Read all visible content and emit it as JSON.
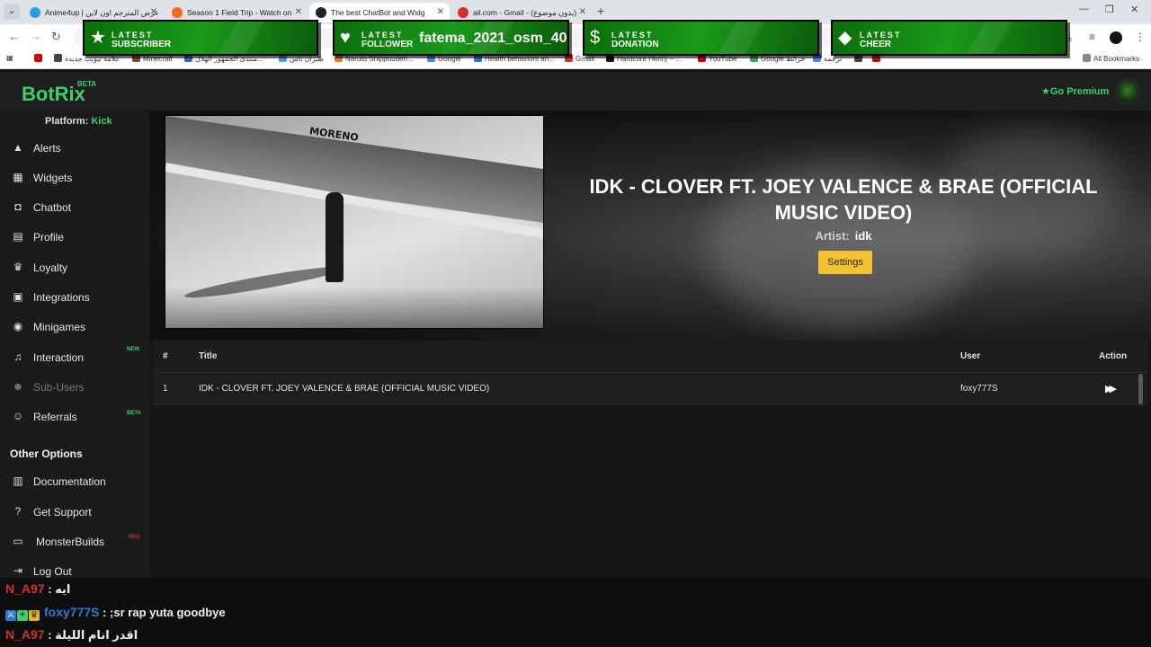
{
  "browser": {
    "tabs": [
      {
        "label": "Anime4up | عرض المترجم اون لاين",
        "color": "#2f9ae0"
      },
      {
        "label": "Season 1 Field Trip - Watch on",
        "color": "#f26b1d"
      },
      {
        "label": "The best ChatBot and Widg",
        "color": "#222222"
      },
      {
        "label": "ail.com - Gmail - (بدون موضوع)",
        "color": "#d93025"
      }
    ],
    "bookmarks": [
      {
        "label": "",
        "color": "#d30000"
      },
      {
        "label": "علامة تبويب جديدة",
        "color": "#444444"
      },
      {
        "label": "Minecraft",
        "color": "#6b4f2a"
      },
      {
        "label": "منتدى الجمهور الهلال...",
        "color": "#2b6cb0"
      },
      {
        "label": "طيران ناس",
        "color": "#3a9fd8"
      },
      {
        "label": "Naruto Shippuuden...",
        "color": "#e07a20"
      },
      {
        "label": "Google",
        "color": "#4285f4"
      },
      {
        "label": "Health behaviors an...",
        "color": "#1a73e8"
      },
      {
        "label": "Gmail",
        "color": "#d93025"
      },
      {
        "label": "Hardcore Henry – ...",
        "color": "#111111"
      },
      {
        "label": "YouTube",
        "color": "#d30000"
      },
      {
        "label": "Google خرائط",
        "color": "#34a853"
      },
      {
        "label": "ترجمة",
        "color": "#4285f4"
      },
      {
        "label": "",
        "color": "#444444"
      },
      {
        "label": "",
        "color": "#d30000"
      }
    ],
    "all_bookmarks": "All Bookmarks"
  },
  "alerts": [
    {
      "line1": "LATEST",
      "line2": "SUBSCRIBER",
      "icon": "star-icon",
      "name": ""
    },
    {
      "line1": "LATEST",
      "line2": "FOLLOWER",
      "icon": "heart-icon",
      "name": "fatema_2021_osm_40"
    },
    {
      "line1": "LATEST",
      "line2": "DONATION",
      "icon": "dollar-icon",
      "name": ""
    },
    {
      "line1": "LATEST",
      "line2": "CHEER",
      "icon": "diamond-icon",
      "name": ""
    }
  ],
  "app": {
    "logo": "BotRix",
    "logo_badge": "BETA",
    "go_premium": "Go Premium",
    "platform_label": "Platform:",
    "platform_value": "Kick"
  },
  "sidebar": {
    "items": [
      {
        "label": "Alerts",
        "icon": "warning-icon"
      },
      {
        "label": "Widgets",
        "icon": "grid-icon"
      },
      {
        "label": "Chatbot",
        "icon": "robot-icon"
      },
      {
        "label": "Profile",
        "icon": "id-card-icon"
      },
      {
        "label": "Loyalty",
        "icon": "trophy-icon"
      },
      {
        "label": "Integrations",
        "icon": "chat-icon"
      },
      {
        "label": "Minigames",
        "icon": "gamepad-icon"
      },
      {
        "label": "Interaction",
        "icon": "music-icon",
        "badge": "NEW"
      },
      {
        "label": "Sub-Users",
        "icon": "users-icon"
      },
      {
        "label": "Referrals",
        "icon": "user-plus-icon",
        "badge": "BETA"
      }
    ],
    "other_title": "Other Options",
    "other_items": [
      {
        "label": "Documentation",
        "icon": "book-icon"
      },
      {
        "label": "Get Support",
        "icon": "question-icon"
      },
      {
        "label": "MonsterBuilds",
        "icon": "laptop-icon",
        "badge": "RED"
      },
      {
        "label": "Log Out",
        "icon": "logout-icon"
      }
    ]
  },
  "player": {
    "title": "IDK - CLOVER FT. JOEY VALENCE & BRAE (OFFICIAL MUSIC VIDEO)",
    "artist_label": "Artist:",
    "artist_value": "idk",
    "settings_label": "Settings",
    "graffiti": "MORENO"
  },
  "queue": {
    "headers": {
      "num": "#",
      "title": "Title",
      "user": "User",
      "action": "Action"
    },
    "rows": [
      {
        "num": "1",
        "title": "IDK - CLOVER FT. JOEY VALENCE & BRAE (OFFICIAL MUSIC VIDEO)",
        "user": "foxy777S"
      }
    ]
  },
  "chat": [
    {
      "user": "N_A97",
      "sep": " : ",
      "msg": "ايه",
      "color": "#d32f2f"
    },
    {
      "user": "foxy777S",
      "sep": " : ",
      "msg": ";sr rap yuta goodbye",
      "color": "#2e7bd6"
    },
    {
      "user": "N_A97",
      "sep": " : ",
      "msg": "اقدر انام الليلة",
      "color": "#d32f2f"
    }
  ],
  "colors": {
    "accent": "#3dd06a",
    "settings_button": "#f2c230",
    "alert_green": "#1a9a1a"
  }
}
